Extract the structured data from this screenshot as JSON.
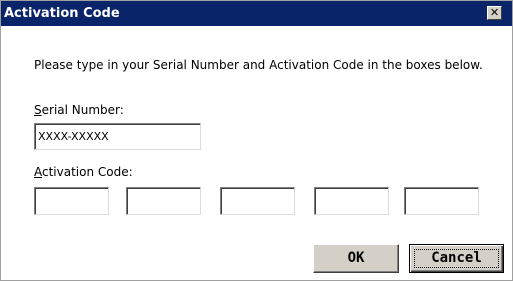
{
  "window": {
    "title": "Activation Code",
    "close_glyph": "✕"
  },
  "instructions": "Please type in your Serial Number and Activation Code in the boxes below.",
  "serial": {
    "label_mnemonic": "S",
    "label_rest": "erial Number:",
    "value": "XXXX-XXXXX"
  },
  "activation": {
    "label_mnemonic": "A",
    "label_rest": "ctivation Code:",
    "boxes": [
      "",
      "",
      "",
      "",
      ""
    ]
  },
  "buttons": {
    "ok_label": "OK",
    "cancel_label": "Cancel"
  },
  "colors": {
    "titlebar": "#0a246a",
    "title_text": "#ffffff",
    "button_face": "#d4d0c8"
  },
  "icons": {
    "close": "close-icon"
  }
}
